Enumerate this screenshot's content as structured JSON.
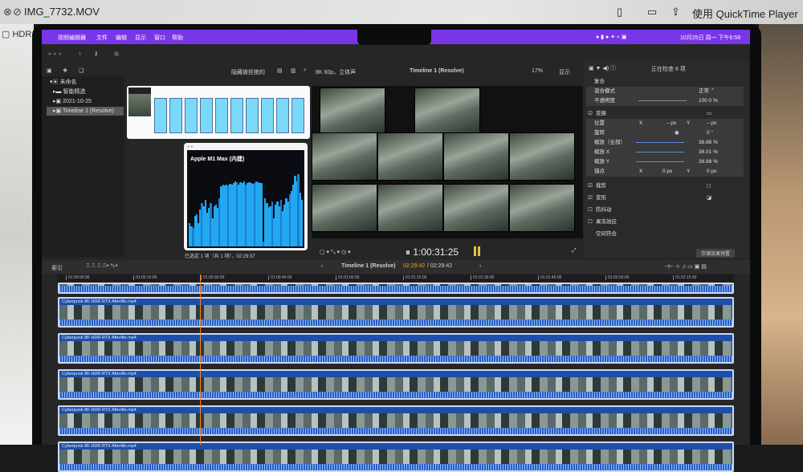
{
  "quicktime": {
    "title": "IMG_7732.MOV",
    "open_with": "使用 QuickTime Player打开",
    "hdr": "HDR"
  },
  "menubar": {
    "app": "视频编辑器",
    "items": [
      "文件",
      "编辑",
      "显示",
      "窗口",
      "帮助"
    ],
    "clock": "10月25日 周一 下午6:58"
  },
  "browser": {
    "filter": "隐藏被拒绝的",
    "format": "8K 60p，立体声",
    "timeline_name": "Timeline 1 (Resolve)",
    "zoom": "17%",
    "view": "显示"
  },
  "sidebar": {
    "items": [
      "未命名",
      "智能精选",
      "2021-10-25",
      "Timeline 1 (Resolve)"
    ]
  },
  "activity": {
    "title": "Apple M1 Max (内建)",
    "gpu_history": [
      30,
      26,
      24,
      40,
      42,
      30,
      48,
      56,
      52,
      60,
      44,
      50,
      56,
      36,
      52,
      54,
      50,
      62,
      78,
      80,
      79,
      80,
      79,
      81,
      80,
      82,
      84,
      83,
      80,
      83,
      82,
      84,
      80,
      82,
      83,
      82,
      81,
      82,
      84,
      83,
      82,
      82,
      6,
      62,
      56,
      50,
      52,
      58,
      36,
      54,
      58,
      52,
      60,
      46,
      54,
      62,
      58,
      68,
      72,
      80,
      92,
      84,
      94,
      70,
      60
    ]
  },
  "selection_status": "已选定 1 项（共 1 项），02:29:37",
  "viewer": {
    "timecode": "1:00:31:25"
  },
  "inspector": {
    "header": "正在检查 8 项",
    "compositing": {
      "title": "复合",
      "blend_label": "混合模式",
      "blend_value": "正常 ⌃",
      "opacity_label": "不透明度",
      "opacity_value": "100.0 %",
      "opacity": 1.0
    },
    "transform": {
      "title": "变换",
      "position": "位置",
      "x": "X",
      "y": "Y",
      "pos_x": "– px",
      "pos_y": "– px",
      "rotation": "旋转",
      "rotation_value": "0 °",
      "scale_all": "缩放（全部）",
      "scale_all_value": "36.88 %",
      "scale_x": "缩放 X",
      "scale_x_value": "36.01 %",
      "scale_y": "缩放 Y",
      "scale_y_value": "36.88 %",
      "anchor": "锚点",
      "anchor_x": "0 px",
      "anchor_y": "0 px"
    },
    "crop": "裁剪",
    "distort": "变形",
    "stabilization": "防抖动",
    "rolling_shutter": "果冻效应",
    "spatial": "空间符合",
    "save_preset": "存储效果预置"
  },
  "timeline": {
    "index": "索引",
    "name": "Timeline 1 (Resolve)",
    "position": "02:29:42",
    "duration": "/ 02:29:42",
    "ruler": [
      "01:00:00:00",
      "01:00:15:00",
      "01:00:30:00",
      "01:00:45:00",
      "01:01:00:00",
      "01:01:15:00",
      "01:01:30:00",
      "01:01:45:00",
      "01:02:00:00",
      "01:02:15:00"
    ],
    "clip_name": "Cyberpunk 8K HDR RTX Afterlife.mp4"
  }
}
